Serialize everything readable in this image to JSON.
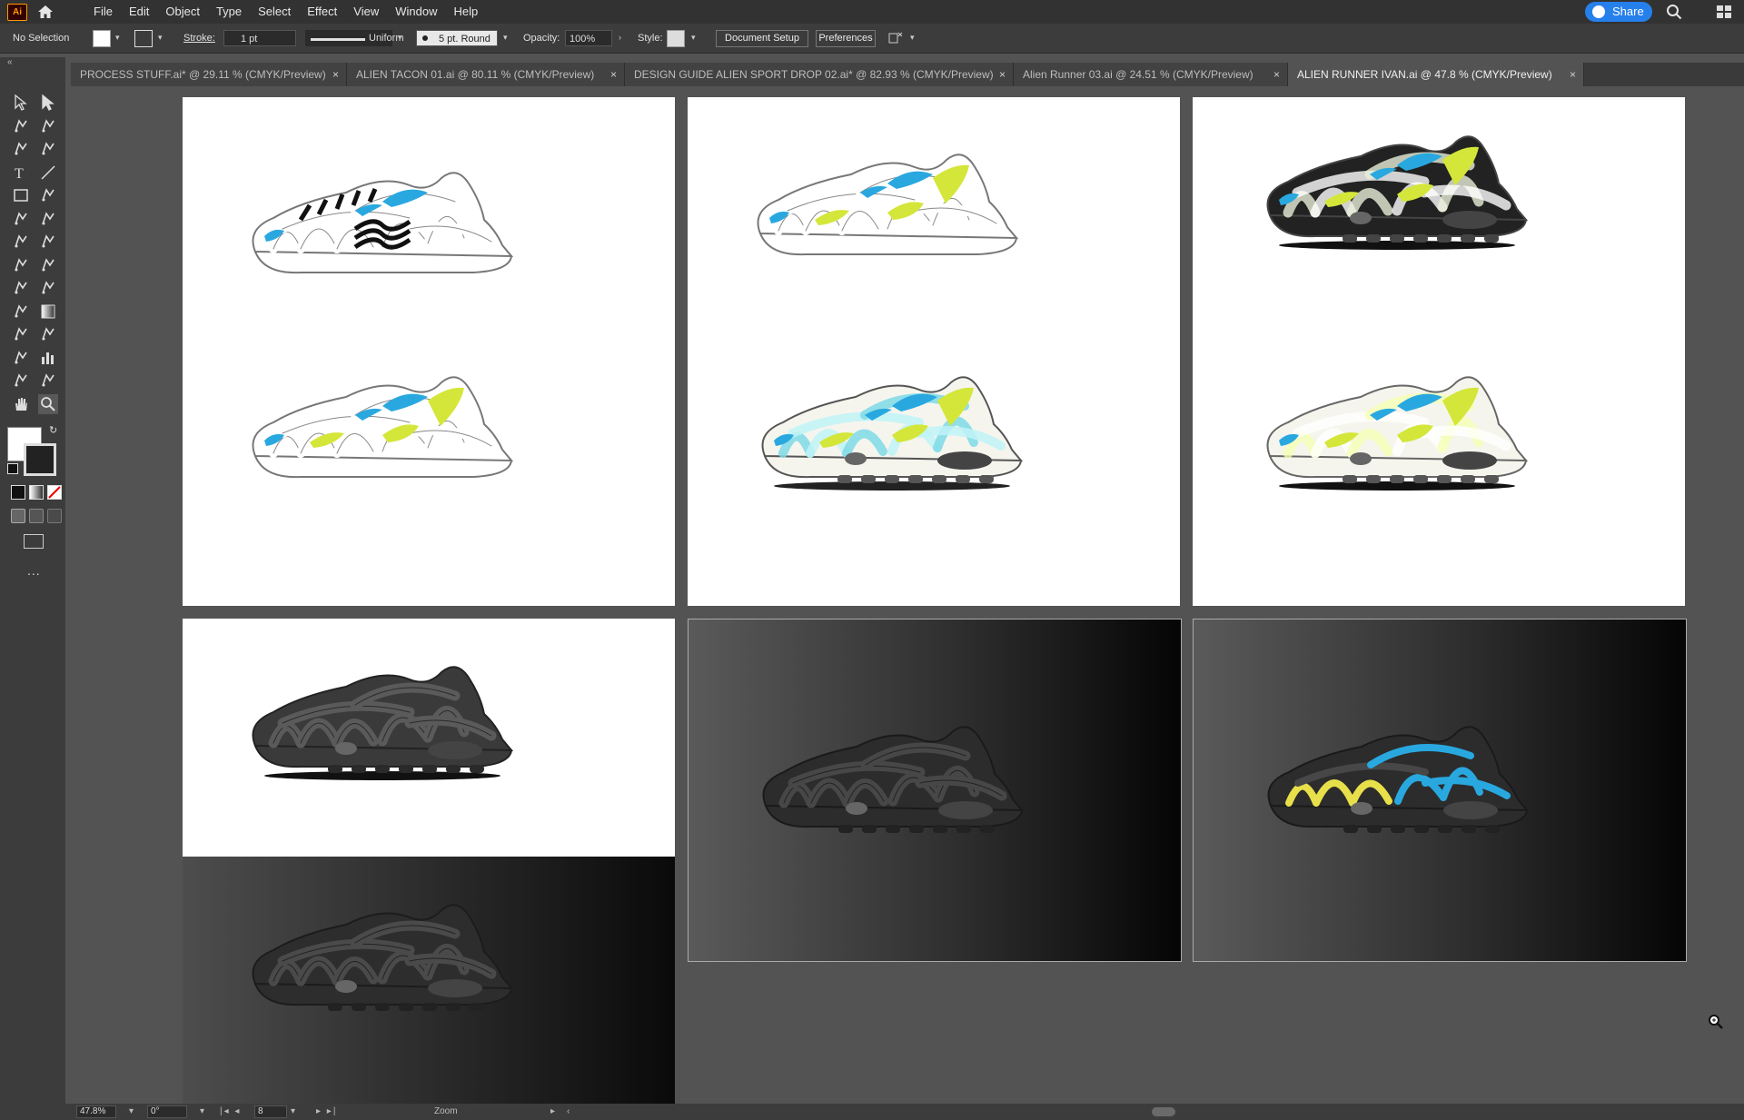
{
  "app": {
    "logo": "Ai",
    "brand_color": "#ff9a00"
  },
  "menu": [
    "File",
    "Edit",
    "Object",
    "Type",
    "Select",
    "Effect",
    "View",
    "Window",
    "Help"
  ],
  "share_label": "Share",
  "control": {
    "selection": "No Selection",
    "stroke_label": "Stroke:",
    "stroke_weight": "1 pt",
    "stroke_profile": "Uniform",
    "brush": "5 pt. Round",
    "opacity_label": "Opacity:",
    "opacity_value": "100%",
    "style_label": "Style:",
    "document_setup": "Document Setup",
    "preferences": "Preferences"
  },
  "tabs": [
    {
      "label": "PROCESS STUFF.ai* @ 29.11 % (CMYK/Preview)",
      "active": false
    },
    {
      "label": "ALIEN TACON 01.ai @ 80.11 % (CMYK/Preview)",
      "active": false
    },
    {
      "label": "DESIGN GUIDE ALIEN SPORT DROP 02.ai* @ 82.93 % (CMYK/Preview)",
      "active": false
    },
    {
      "label": "Alien Runner 03.ai @ 24.51 % (CMYK/Preview)",
      "active": false
    },
    {
      "label": "ALIEN RUNNER IVAN.ai @ 47.8 % (CMYK/Preview)",
      "active": true
    }
  ],
  "tab_close": "×",
  "colors": {
    "accent_blue": "#29a8e0",
    "accent_lime": "#d4e63a",
    "ui_dark": "#323232",
    "canvas": "#535353"
  },
  "status": {
    "zoom": "47.8%",
    "rotation": "0°",
    "artboard": "8",
    "tool": "Zoom"
  },
  "toolbar_more": "..."
}
